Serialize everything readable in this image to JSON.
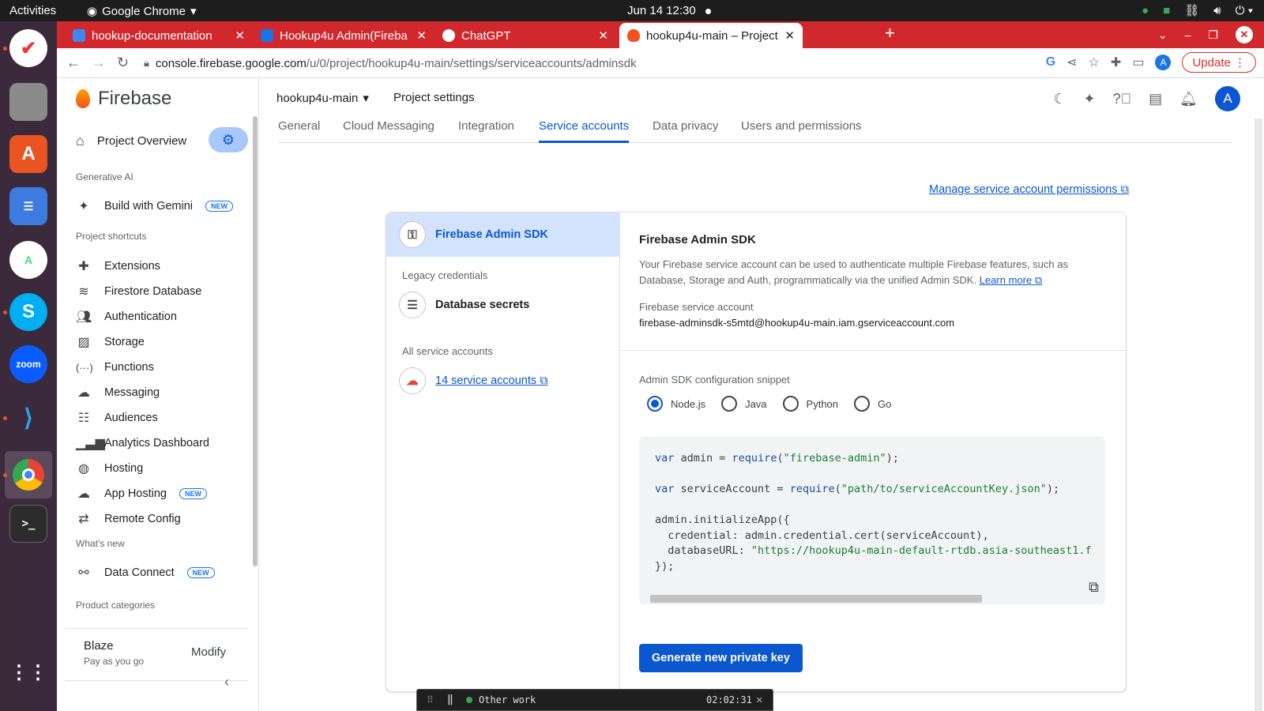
{
  "os": {
    "activities": "Activities",
    "app_name": "Google Chrome",
    "clock": "Jun 14  12:30"
  },
  "browser": {
    "tabs": [
      {
        "title": "hookup-documentation",
        "icon_color": "#4285f4"
      },
      {
        "title": "Hookup4u Admin(Fireba",
        "icon_color": "#1a73e8"
      },
      {
        "title": "ChatGPT",
        "icon_color": "#202124"
      },
      {
        "title": "hookup4u-main – Project",
        "icon_color": "#f4511e"
      }
    ],
    "url_host": "console.firebase.google.com",
    "url_path": "/u/0/project/hookup4u-main/settings/serviceaccounts/adminsdk",
    "update_label": "Update",
    "profile_initial": "A"
  },
  "firebase": {
    "logo_text": "Firebase",
    "project_name": "hookup4u-main",
    "page_title": "Project settings",
    "avatar_initial": "A",
    "nav": {
      "overview": "Project Overview",
      "section_genai": "Generative AI",
      "gemini": "Build with Gemini",
      "new_badge": "NEW",
      "section_shortcuts": "Project shortcuts",
      "extensions": "Extensions",
      "firestore": "Firestore Database",
      "authentication": "Authentication",
      "storage": "Storage",
      "functions": "Functions",
      "messaging": "Messaging",
      "audiences": "Audiences",
      "analytics": "Analytics Dashboard",
      "hosting": "Hosting",
      "app_hosting": "App Hosting",
      "remote_config": "Remote Config",
      "section_whatsnew": "What's new",
      "data_connect": "Data Connect",
      "section_products": "Product categories",
      "plan_name": "Blaze",
      "plan_desc": "Pay as you go",
      "modify": "Modify"
    },
    "settings_tabs": [
      "General",
      "Cloud Messaging",
      "Integration",
      "Service accounts",
      "Data privacy",
      "Users and permissions"
    ],
    "manage_link": "Manage service account permissions",
    "card": {
      "left_selected": "Firebase Admin SDK",
      "legacy_label": "Legacy credentials",
      "db_secrets": "Database secrets",
      "all_label": "All service accounts",
      "service_accounts_link": "14 service accounts",
      "title": "Firebase Admin SDK",
      "desc": "Your Firebase service account can be used to authenticate multiple Firebase features, such as Database, Storage and Auth, programmatically via the unified Admin SDK.",
      "learn_more": "Learn more",
      "acct_label": "Firebase service account",
      "acct_email": "firebase-adminsdk-s5mtd@hookup4u-main.iam.gserviceaccount.com",
      "snippet_label": "Admin SDK configuration snippet",
      "radio_options": [
        "Node.js",
        "Java",
        "Python",
        "Go"
      ],
      "selected_radio": "Node.js",
      "code": {
        "l1a": "var",
        "l1b": " admin = ",
        "l1c": "require",
        "l1d": "(",
        "l1e": "\"firebase-admin\"",
        "l1f": ");",
        "l2a": "var",
        "l2b": " serviceAccount = ",
        "l2c": "require",
        "l2d": "(",
        "l2e": "\"path/to/serviceAccountKey.json\"",
        "l2f": ");",
        "l3": "admin.initializeApp({",
        "l4": "  credential: admin.credential.cert(serviceAccount),",
        "l5a": "  databaseURL: ",
        "l5b": "\"https://hookup4u-main-default-rtdb.asia-southeast1.f",
        "l6": "});"
      },
      "generate_button": "Generate new private key"
    }
  },
  "tracker": {
    "label": "Other work",
    "time": "02:02:31"
  }
}
